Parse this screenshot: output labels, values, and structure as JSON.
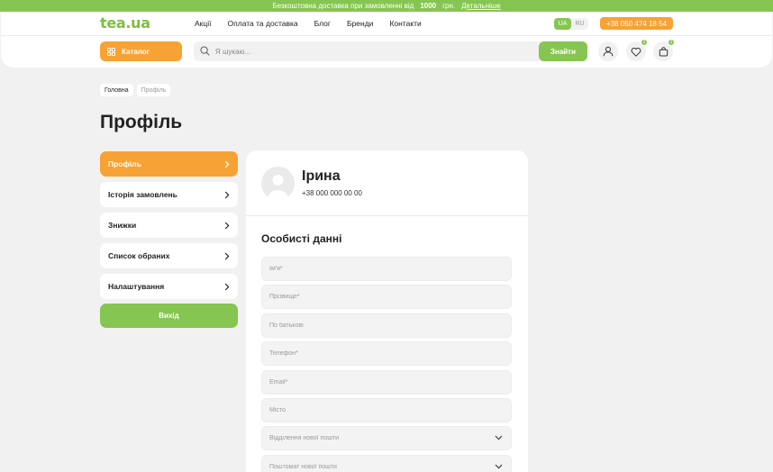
{
  "topbar": {
    "text_before": "Безкоштовна доставка при замовленні від",
    "amount": "1000",
    "currency": "грн.",
    "link": "Детальніше"
  },
  "header": {
    "logo": "tea.ua",
    "menu": [
      "Акції",
      "Оплата та доставка",
      "Блог",
      "Бренди",
      "Контакти"
    ],
    "lang": {
      "ua": "UA",
      "ru": "RU"
    },
    "phone": "+38 050 474 18 54",
    "catalog_label": "Каталог",
    "search_placeholder": "Я шукаю...",
    "search_button": "Знайти",
    "favorites_count": "1",
    "cart_count": "1"
  },
  "breadcrumb": [
    "Головна",
    "Профіль"
  ],
  "page_title": "Профіль",
  "sidebar": {
    "items": [
      {
        "label": "Профіль"
      },
      {
        "label": "Історія замовлень"
      },
      {
        "label": "Знижки"
      },
      {
        "label": "Список обраних"
      },
      {
        "label": "Налаштування"
      }
    ],
    "logout": "Вихід"
  },
  "profile": {
    "name": "Ірина",
    "phone": "+38 000 000 00 00",
    "section_title": "Особисті данні",
    "fields": [
      {
        "placeholder": "Ім'я*"
      },
      {
        "placeholder": "Прізвище*"
      },
      {
        "placeholder": "По батькові"
      },
      {
        "placeholder": "Телефон*"
      },
      {
        "placeholder": "Email*"
      },
      {
        "placeholder": "Місто"
      },
      {
        "placeholder": "Відділення нової пошти"
      },
      {
        "placeholder": "Поштомат нової пошти"
      }
    ]
  },
  "colors": {
    "green": "#86c551",
    "orange": "#f7a234",
    "background": "#f1f1f1"
  }
}
